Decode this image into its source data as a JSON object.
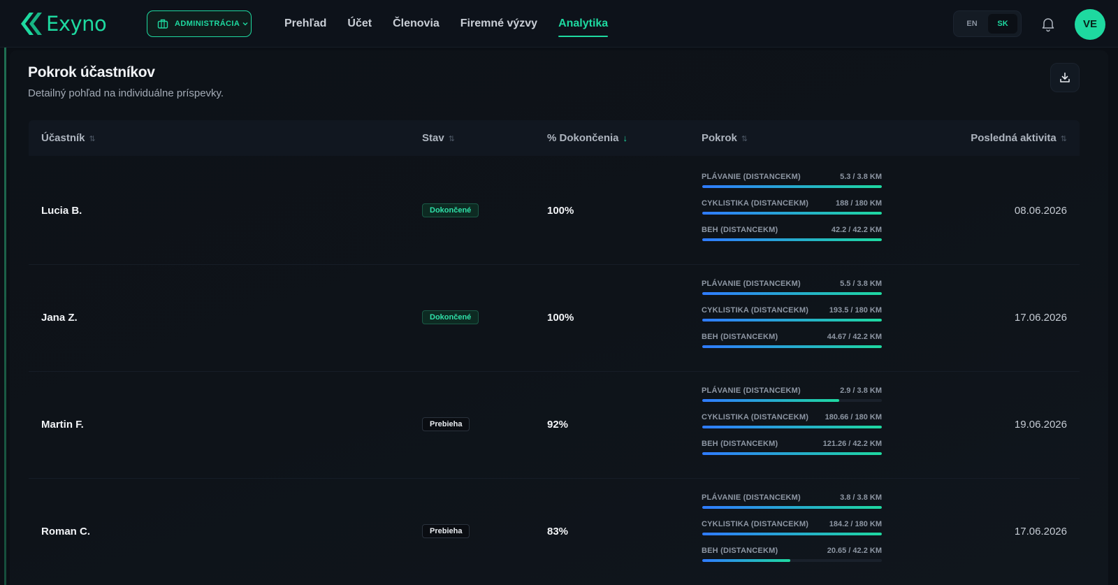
{
  "app": {
    "brand": "Exyno",
    "org_button": "ADMINISTRÁCIA",
    "nav": [
      {
        "label": "Prehľad",
        "active": false
      },
      {
        "label": "Účet",
        "active": false
      },
      {
        "label": "Členovia",
        "active": false
      },
      {
        "label": "Firemné výzvy",
        "active": false
      },
      {
        "label": "Analytika",
        "active": true
      }
    ],
    "languages": [
      {
        "code": "EN",
        "active": false
      },
      {
        "code": "SK",
        "active": true
      }
    ],
    "avatar_initials": "VE",
    "accent_color": "#1ed9a0"
  },
  "section": {
    "title": "Pokrok účastníkov",
    "subtitle": "Detailný pohľad na individuálne príspevky."
  },
  "table": {
    "columns": [
      "Účastník",
      "Stav",
      "% Dokončenia",
      "Pokrok",
      "Posledná aktivita"
    ],
    "rows": [
      {
        "name": "Lucia B.",
        "status": "Dokončené",
        "status_type": "done",
        "percent": "100%",
        "progress": [
          {
            "label": "PLÁVANIE (DISTANCEKM)",
            "value": "5.3 / 3.8 KM",
            "fraction": 1
          },
          {
            "label": "CYKLISTIKA (DISTANCEKM)",
            "value": "188 / 180 KM",
            "fraction": 1
          },
          {
            "label": "BEH (DISTANCEKM)",
            "value": "42.2 / 42.2 KM",
            "fraction": 1
          }
        ],
        "last_activity": "08.06.2026"
      },
      {
        "name": "Jana Z.",
        "status": "Dokončené",
        "status_type": "done",
        "percent": "100%",
        "progress": [
          {
            "label": "PLÁVANIE (DISTANCEKM)",
            "value": "5.5 / 3.8 KM",
            "fraction": 1
          },
          {
            "label": "CYKLISTIKA (DISTANCEKM)",
            "value": "193.5 / 180 KM",
            "fraction": 1
          },
          {
            "label": "BEH (DISTANCEKM)",
            "value": "44.67 / 42.2 KM",
            "fraction": 1
          }
        ],
        "last_activity": "17.06.2026"
      },
      {
        "name": "Martin F.",
        "status": "Prebieha",
        "status_type": "prog",
        "percent": "92%",
        "progress": [
          {
            "label": "PLÁVANIE (DISTANCEKM)",
            "value": "2.9 / 3.8 KM",
            "fraction": 0.763
          },
          {
            "label": "CYKLISTIKA (DISTANCEKM)",
            "value": "180.66 / 180 KM",
            "fraction": 1
          },
          {
            "label": "BEH (DISTANCEKM)",
            "value": "121.26 / 42.2 KM",
            "fraction": 1
          }
        ],
        "last_activity": "19.06.2026"
      },
      {
        "name": "Roman C.",
        "status": "Prebieha",
        "status_type": "prog",
        "percent": "83%",
        "progress": [
          {
            "label": "PLÁVANIE (DISTANCEKM)",
            "value": "3.8 / 3.8 KM",
            "fraction": 1
          },
          {
            "label": "CYKLISTIKA (DISTANCEKM)",
            "value": "184.2 / 180 KM",
            "fraction": 1
          },
          {
            "label": "BEH (DISTANCEKM)",
            "value": "20.65 / 42.2 KM",
            "fraction": 0.489
          }
        ],
        "last_activity": "17.06.2026"
      }
    ]
  }
}
